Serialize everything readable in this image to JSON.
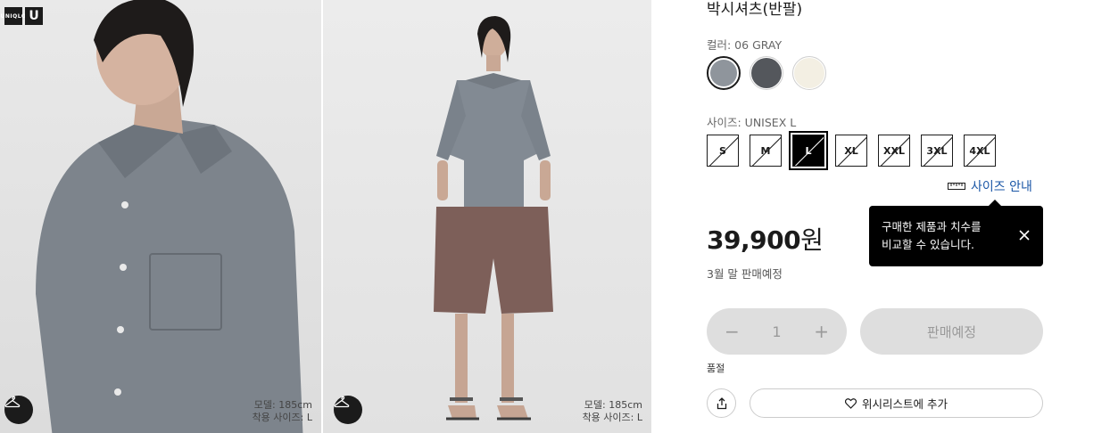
{
  "brand": {
    "logo_text": "UNIQLO",
    "logo_letter": "U"
  },
  "gallery": {
    "photo1": {
      "model_height": "모델: 185cm",
      "model_size": "착용 사이즈: L"
    },
    "photo2": {
      "model_height": "모델: 185cm",
      "model_size": "착용 사이즈: L"
    }
  },
  "product": {
    "title": "박시셔츠(반팔)",
    "color_label": "컬러: 06 GRAY",
    "colors": [
      {
        "name": "GRAY",
        "hex": "#8f959c",
        "selected": true
      },
      {
        "name": "DARK GRAY",
        "hex": "#54575c",
        "selected": false
      },
      {
        "name": "OFF WHITE",
        "hex": "#f3efe3",
        "selected": false
      }
    ],
    "size_label": "사이즈: UNISEX L",
    "sizes": [
      "S",
      "M",
      "L",
      "XL",
      "XXL",
      "3XL",
      "4XL"
    ],
    "selected_size": "L",
    "size_guide": "사이즈 안내",
    "tooltip": {
      "line1": "구매한 제품과 치수를",
      "line2": "비교할 수 있습니다."
    },
    "price": "39,900",
    "currency": "원",
    "sale_date": "3월 말 판매예정",
    "quantity": {
      "minus": "−",
      "value": "1",
      "plus": "+"
    },
    "cta_label": "판매예정",
    "stock_status": "품절",
    "wishlist_label": "위시리스트에 추가"
  }
}
